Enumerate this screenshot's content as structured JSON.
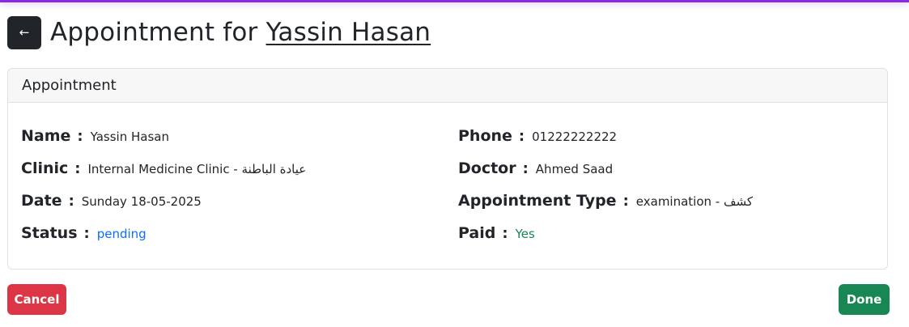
{
  "header": {
    "back_icon": "←",
    "title_prefix": "Appointment for",
    "patient_name": "Yassin Hasan"
  },
  "card": {
    "title": "Appointment",
    "separator": ":",
    "left": [
      {
        "label": "Name",
        "value": "Yassin Hasan"
      },
      {
        "label": "Clinic",
        "value": "Internal Medicine Clinic - عيادة الباطنة"
      },
      {
        "label": "Date",
        "value": "Sunday 18-05-2025"
      },
      {
        "label": "Status",
        "value": "pending"
      }
    ],
    "right": [
      {
        "label": "Phone",
        "value": "01222222222"
      },
      {
        "label": "Doctor",
        "value": "Ahmed Saad"
      },
      {
        "label": "Appointment Type",
        "value": "examination - كشف"
      },
      {
        "label": "Paid",
        "value": "Yes"
      }
    ]
  },
  "actions": {
    "cancel_label": "Cancel",
    "done_label": "Done"
  },
  "colors": {
    "status": "#0d6efd",
    "paid": "#198754",
    "cancel": "#dc3545",
    "done": "#198754",
    "accent_bar": "#8a2be2"
  }
}
